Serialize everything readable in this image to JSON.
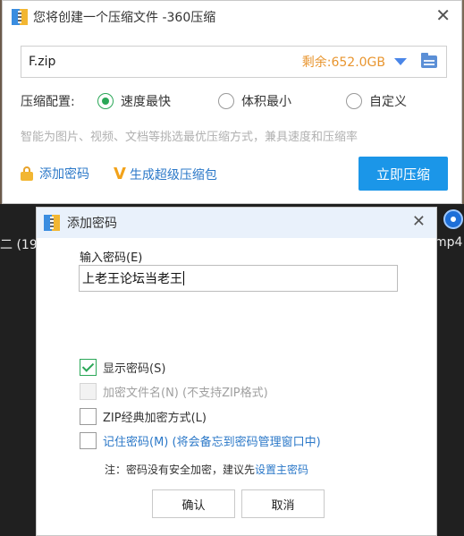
{
  "desktop": {
    "left_fragment": "二 (19",
    "right_fragment": "mp4"
  },
  "main_window": {
    "title": "您将创建一个压缩文件 -360压缩",
    "close_glyph": "✕",
    "path": {
      "value": "F.zip",
      "space_left": "剩余:652.0GB"
    },
    "config": {
      "label": "压缩配置:",
      "options": [
        "速度最快",
        "体积最小",
        "自定义"
      ],
      "selected": "速度最快"
    },
    "hint": "智能为图片、视频、文档等挑选最优压缩方式，兼具速度和压缩率",
    "add_password_label": "添加密码",
    "v_glyph": "V",
    "super_pack_label": "生成超级压缩包",
    "compress_button": "立即压缩"
  },
  "password_dialog": {
    "title": "添加密码",
    "close_glyph": "✕",
    "input_label": "输入密码(E)",
    "input_value": "上老王论坛当老王",
    "show_password": {
      "label": "显示密码(S)",
      "checked": true
    },
    "encrypt_filenames": {
      "label": "加密文件名(N) (不支持ZIP格式)",
      "checked": false,
      "disabled": true
    },
    "zip_classic": {
      "label": "ZIP经典加密方式(L)",
      "checked": false
    },
    "remember_password": {
      "label": "记住密码(M) (将会备忘到密码管理窗口中)",
      "checked": false
    },
    "note_prefix": "注：密码没有安全加密，建议先",
    "note_link": "设置主密码",
    "ok_button": "确认",
    "cancel_button": "取消"
  },
  "colors": {
    "accent_blue": "#1b96e8",
    "link_blue": "#2b78c8",
    "orange": "#e8952f",
    "green_check": "#2aa757"
  }
}
